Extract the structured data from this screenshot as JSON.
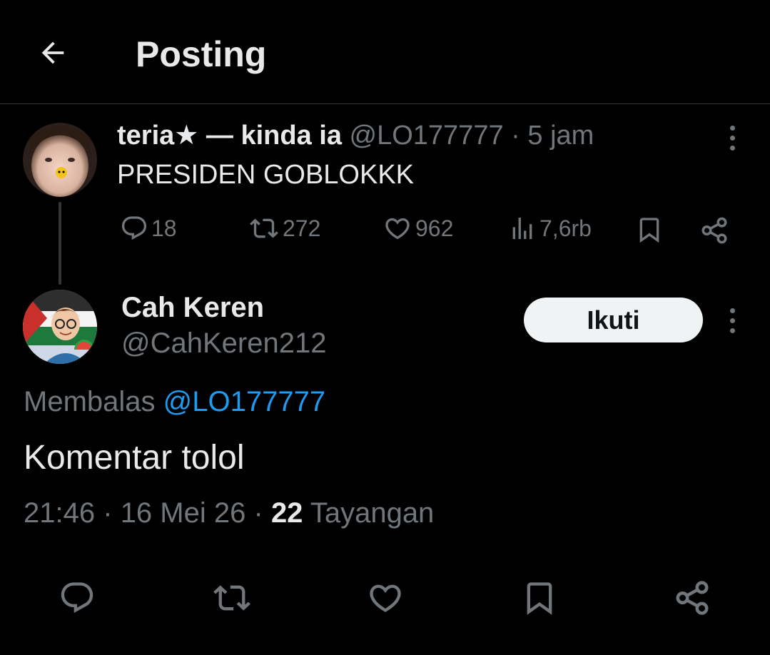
{
  "header": {
    "title": "Posting",
    "back_icon": "arrow-left-icon"
  },
  "parent_post": {
    "display_name": "teria★ — kinda ia",
    "handle": "@LO177777",
    "separator": "·",
    "time": "5 jam",
    "text": "PRESIDEN GOBLOKKK",
    "stats": {
      "replies": "18",
      "reposts": "272",
      "likes": "962",
      "views": "7,6rb"
    }
  },
  "reply_post": {
    "display_name": "Cah Keren",
    "handle": "@CahKeren212",
    "follow_label": "Ikuti",
    "replying_to_label": "Membalas",
    "replying_to_handle": "@LO177777",
    "text": "Komentar tolol",
    "time": "21:46",
    "sep1": "·",
    "date": "16 Mei 26",
    "sep2": "·",
    "views_count": "22",
    "views_label": "Tayangan"
  },
  "colors": {
    "background": "#000000",
    "primary_text": "#e7e9ea",
    "secondary_text": "#71767b",
    "link": "#1d9bf0",
    "follow_bg": "#eff3f4"
  }
}
